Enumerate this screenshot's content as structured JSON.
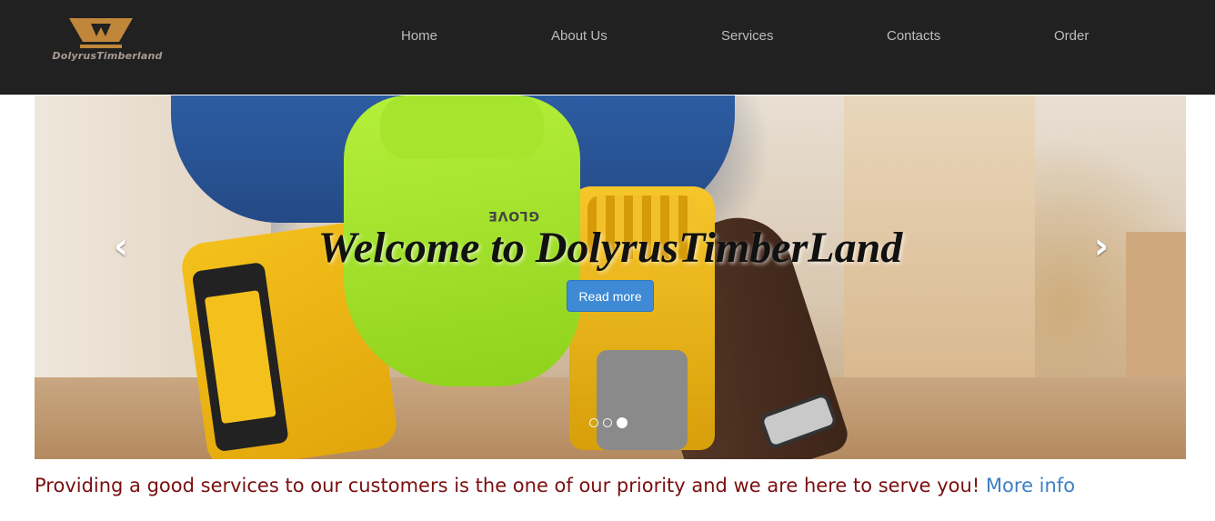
{
  "brand": {
    "name": "DolyrusTimberland",
    "logo_color": "#c0873a"
  },
  "nav": {
    "items": [
      {
        "label": "Home"
      },
      {
        "label": "About Us"
      },
      {
        "label": "Services"
      },
      {
        "label": "Contacts"
      },
      {
        "label": "Order"
      }
    ]
  },
  "carousel": {
    "caption_title": "Welcome to DolyrusTimberLand",
    "button_label": "Read more",
    "button_color": "#3e8ad4",
    "prev_icon": "chevron-left-icon",
    "next_icon": "chevron-right-icon",
    "slide_count": 3,
    "active_slide": 3,
    "glove_print": "GLOVE"
  },
  "tagline": {
    "text": "Providing a good services to our customers is the one of our priority and we are here to serve you!",
    "link_label": "More info",
    "text_color": "#7a0f0f",
    "link_color": "#3e7fc4"
  }
}
